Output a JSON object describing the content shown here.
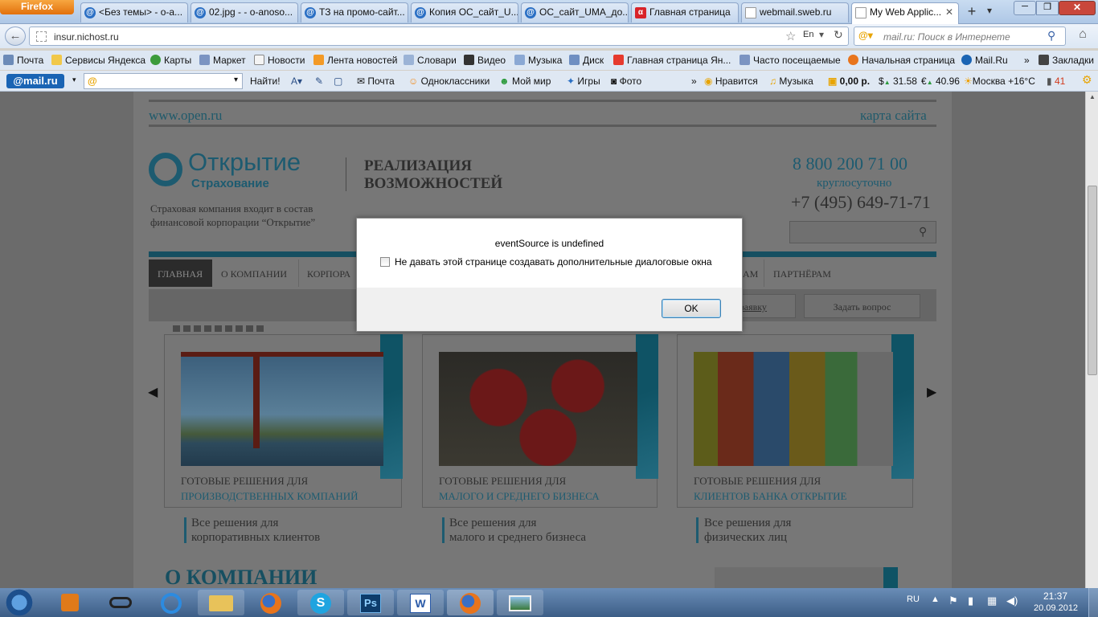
{
  "browser": {
    "app_button": "Firefox",
    "tabs": [
      {
        "label": "<Без темы> - o-a...",
        "icon": "mail-at-icon"
      },
      {
        "label": "02.jpg - - o-anoso...",
        "icon": "mail-at-icon"
      },
      {
        "label": "ТЗ на промо-сайт...",
        "icon": "mail-at-icon"
      },
      {
        "label": "Копия ОС_сайт_U...",
        "icon": "mail-at-icon"
      },
      {
        "label": "ОС_сайт_UMA_до...",
        "icon": "mail-at-icon"
      },
      {
        "label": "Главная страница",
        "icon": "alpha-icon"
      },
      {
        "label": "webmail.sweb.ru",
        "icon": "page-icon"
      },
      {
        "label": "My Web Applic...",
        "icon": "page-icon"
      }
    ],
    "address": "insur.nichost.ru",
    "search_placeholder": "mail.ru: Поиск в Интернете"
  },
  "bookmarks": [
    "Почта",
    "Сервисы Яндекса",
    "Карты",
    "Маркет",
    "Новости",
    "Лента новостей",
    "Словари",
    "Видео",
    "Музыка",
    "Диск",
    "Главная страница Ян...",
    "Часто посещаемые",
    "Начальная страница",
    "Mail.Ru",
    "Закладки"
  ],
  "mailru_bar": {
    "logo": "@mail.ru",
    "find_button": "Найти!",
    "items": [
      "Почта",
      "Одноклассники",
      "Мой мир",
      "Игры",
      "Фото"
    ],
    "likes": "Нравится",
    "music": "Музыка",
    "balance": "0,00 р.",
    "usd": "31.58",
    "eur": "40.96",
    "weather": "Москва +16°C",
    "count": "41"
  },
  "site": {
    "domain_link": "www.open.ru",
    "sitemap": "карта сайта",
    "logo_title": "Открытие",
    "logo_sub": "Страхование",
    "slogan": "РЕАЛИЗАЦИЯ ВОЗМОЖНОСТЕЙ",
    "description": "Страховая компания входит в состав финансовой корпорации “Открытие”",
    "phone_main": "8 800 200 71 00",
    "phone_note": "круглосуточно",
    "phone_alt": "+7 (495) 649-71-71",
    "menu": [
      "ГЛАВНАЯ",
      "О КОМПАНИИ",
      "КОРПОРА",
      "АМ",
      "ПАРТНЁРАМ"
    ],
    "request_link": "заявку",
    "ask_button": "Задать вопрос",
    "cards": [
      {
        "title1": "ГОТОВЫЕ РЕШЕНИЯ ДЛЯ",
        "title2": "ПРОИЗВОДСТВЕННЫХ КОМПАНИЙ",
        "link1": "Все решения для",
        "link2": "корпоративных клиентов"
      },
      {
        "title1": "ГОТОВЫЕ РЕШЕНИЯ ДЛЯ",
        "title2": "МАЛОГО И СРЕДНЕГО БИЗНЕСА",
        "link1": "Все решения для",
        "link2": "малого и среднего бизнеса"
      },
      {
        "title1": "ГОТОВЫЕ РЕШЕНИЯ ДЛЯ",
        "title2": "КЛИЕНТОВ БАНКА ОТКРЫТИЕ",
        "link1": "Все решения для",
        "link2": "физических лиц"
      }
    ],
    "about_heading": "О КОМПАНИИ"
  },
  "dialog": {
    "message": "eventSource is undefined",
    "checkbox_label": "Не давать этой странице создавать дополнительные диалоговые окна",
    "checkbox_checked": false,
    "ok_label": "OK"
  },
  "taskbar": {
    "lang": "RU",
    "time": "21:37",
    "date": "20.09.2012"
  },
  "colors": {
    "accent": "#2a9fc0",
    "overlay": "#6b6b6b"
  }
}
